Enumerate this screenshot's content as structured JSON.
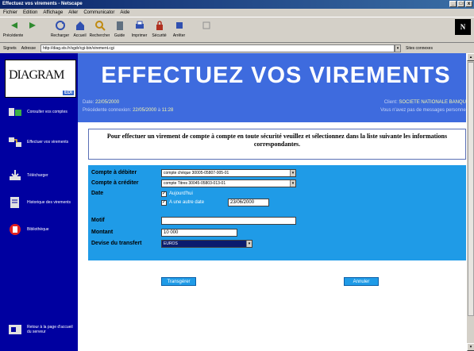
{
  "window": {
    "title": "Effectuez vos virements - Netscape",
    "controls": [
      "_",
      "□",
      "x"
    ]
  },
  "menu": [
    "Fichier",
    "Edition",
    "Affichage",
    "Aller",
    "Communicator",
    "Aide"
  ],
  "toolbar": {
    "buttons": [
      {
        "label": "Précédente",
        "icon": "back-arrow-icon",
        "color": "#2f8a2f"
      },
      {
        "label": "",
        "icon": "forward-arrow-icon",
        "color": "#2f8a2f"
      },
      {
        "label": "Recharger",
        "icon": "reload-icon",
        "color": "#3050b0"
      },
      {
        "label": "Accueil",
        "icon": "home-icon",
        "color": "#3050b0"
      },
      {
        "label": "Rechercher",
        "icon": "search-icon",
        "color": "#c08a10"
      },
      {
        "label": "Guide",
        "icon": "guide-icon",
        "color": "#607080"
      },
      {
        "label": "Imprimer",
        "icon": "print-icon",
        "color": "#3050b0"
      },
      {
        "label": "Sécurité",
        "icon": "lock-icon",
        "color": "#b03020"
      },
      {
        "label": "Arrêter",
        "icon": "stop-icon",
        "color": "#3050b0"
      },
      {
        "label": "",
        "icon": "stop-disabled-icon",
        "color": "#909090"
      }
    ],
    "brand": "N"
  },
  "address": {
    "bookmarks_label": "Signets",
    "location_label": "Adresse",
    "url": "http://diag.sts.fr/sgdr/cgi-bin/virement.cgi",
    "related_label": "Sites connexes"
  },
  "sidebar": {
    "logo": "DIAGRAM",
    "logo_sub": "EDI",
    "items": [
      {
        "label": "Consulter vos comptes",
        "icon": "accounts-icon"
      },
      {
        "label": "Effectuer vos virements",
        "icon": "transfer-icon"
      },
      {
        "label": "Télécharger",
        "icon": "download-icon"
      },
      {
        "label": "Historique des virements",
        "icon": "history-icon"
      },
      {
        "label": "Bibliothèque",
        "icon": "library-icon"
      }
    ],
    "footer_label": "Retour à la page d'accueil du serveur",
    "footer_icon": "exit-icon"
  },
  "header": {
    "title": "EFFECTUEZ VOS VIREMENTS"
  },
  "info": {
    "date_label": "Date:",
    "date_value": "22/05/2000",
    "client_label": "Client:",
    "client_value": "SOCIETE NATIONALE BANQUE",
    "prev_connection_label": "Précédente connexion:",
    "prev_connection_date": "22/05/2000",
    "prev_connection_sep": "à",
    "prev_connection_time": "11:28",
    "messages_text": "Vous n'avez pas de messages personnels"
  },
  "instruction": "Pour effectuer un virement de compte à compte en toute sécurité veuillez et sélectionnez dans la liste suivante les informations correspondantes.",
  "form": {
    "debit_label": "Compte à débiter",
    "debit_value": "compte chèque 30005-05807-005-01",
    "credit_label": "Compte à créditer",
    "credit_value": "compte Titres 30045-05803-013-01",
    "date_label": "Date",
    "opt_immediate": "Aujourd'hui",
    "opt_later": "A une autre date",
    "later_date": "23/06/2000",
    "motif_label": "Motif",
    "motif_value": "",
    "amount_label": "Montant",
    "amount_value": "10 000",
    "currency_label": "Devise du transfert",
    "currency_value": "EUROS"
  },
  "buttons": {
    "validate": "Transgérer",
    "cancel": "Annuler"
  }
}
